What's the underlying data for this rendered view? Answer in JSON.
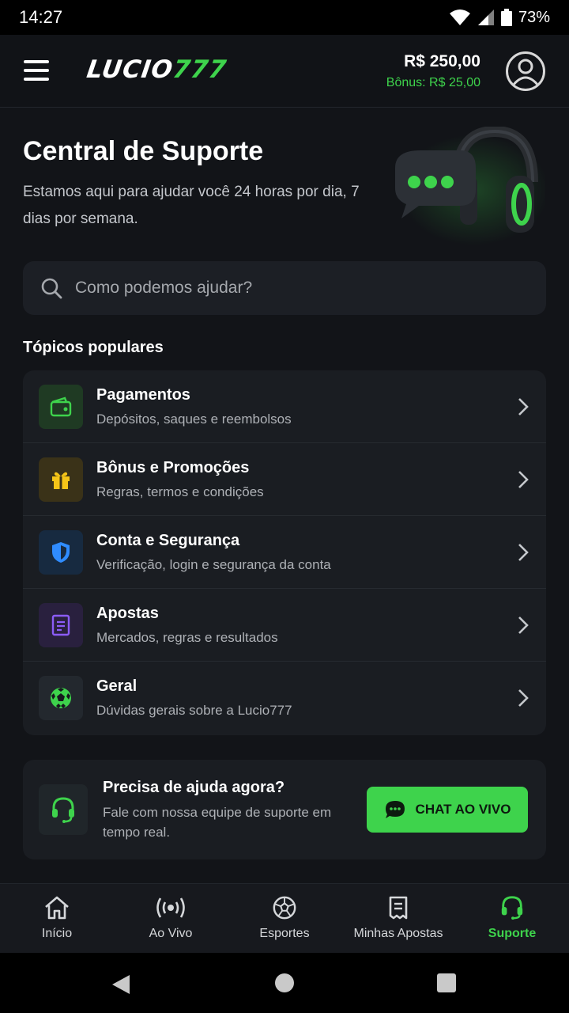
{
  "status_bar": {
    "time": "14:27",
    "battery": "73%"
  },
  "header": {
    "logo_main": "LUCIO",
    "logo_accent": "777",
    "balance": "R$ 250,00",
    "bonus": "Bônus: R$ 25,00"
  },
  "hero": {
    "title": "Central de Suporte",
    "subtitle": "Estamos aqui para ajudar você 24 horas por dia, 7 dias por semana."
  },
  "search": {
    "placeholder": "Como podemos ajudar?"
  },
  "popular": {
    "title": "Tópicos populares",
    "topics": [
      {
        "title": "Pagamentos",
        "desc": "Depósitos, saques e reembolsos",
        "icon": "wallet-icon",
        "color": "#3ed34c"
      },
      {
        "title": "Bônus e Promoções",
        "desc": "Regras, termos e condições",
        "icon": "gift-icon",
        "color": "#f5c518"
      },
      {
        "title": "Conta e Segurança",
        "desc": "Verificação, login e segurança da conta",
        "icon": "shield-icon",
        "color": "#2f8cff"
      },
      {
        "title": "Apostas",
        "desc": "Mercados, regras e resultados",
        "icon": "ticket-icon",
        "color": "#8b5cf6"
      },
      {
        "title": "Geral",
        "desc": "Dúvidas gerais sobre a Lucio777",
        "icon": "soccer-ball-icon",
        "color": "#3ed34c"
      }
    ]
  },
  "help": {
    "title": "Precisa de ajuda agora?",
    "desc": "Fale com nossa equipe de suporte em tempo real.",
    "button": "CHAT AO VIVO"
  },
  "bottom_nav": {
    "items": [
      {
        "label": "Início",
        "icon": "home-icon"
      },
      {
        "label": "Ao Vivo",
        "icon": "live-broadcast-icon"
      },
      {
        "label": "Esportes",
        "icon": "soccer-ball-icon"
      },
      {
        "label": "Minhas Apostas",
        "icon": "bet-slip-icon"
      },
      {
        "label": "Suporte",
        "icon": "headset-icon",
        "active": true
      }
    ]
  },
  "colors": {
    "accent": "#3ed34c",
    "background": "#121418",
    "card": "#1a1d22"
  }
}
